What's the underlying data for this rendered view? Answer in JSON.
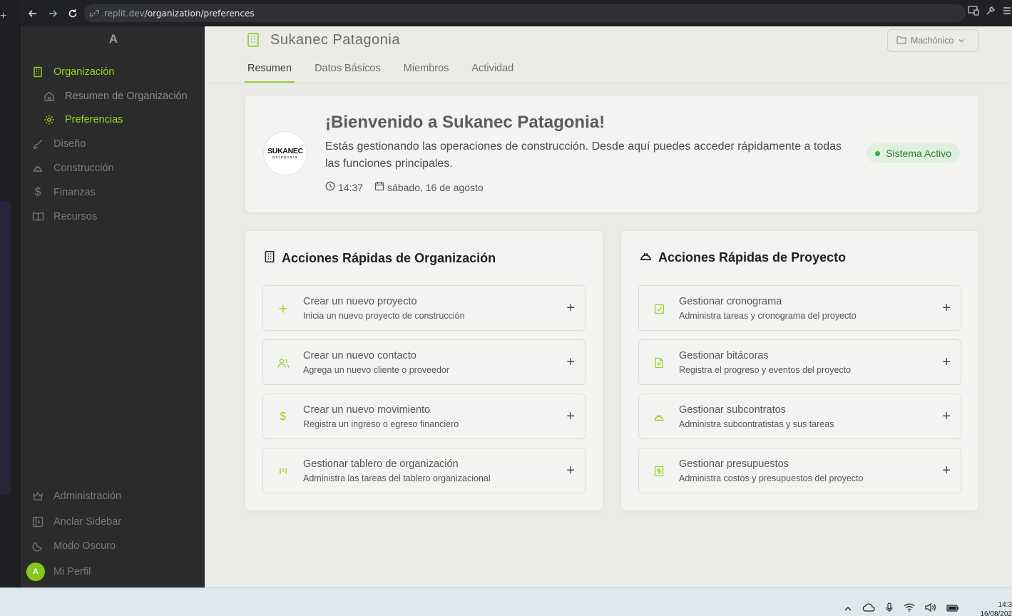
{
  "browser": {
    "url_host": ".replit.dev",
    "url_path": "/organization/preferences"
  },
  "sidebar": {
    "logo_letter": "A",
    "items": [
      {
        "label": "Organización",
        "icon": "building-icon",
        "active": true
      },
      {
        "label": "Resumen de Organización",
        "icon": "home-icon",
        "sub": true
      },
      {
        "label": "Preferencias",
        "icon": "gear-icon",
        "sub": true,
        "active": true
      },
      {
        "label": "Diseño",
        "icon": "brush-icon"
      },
      {
        "label": "Construcción",
        "icon": "hardhat-icon"
      },
      {
        "label": "Finanzas",
        "icon": "dollar-icon"
      },
      {
        "label": "Recursos",
        "icon": "book-icon"
      }
    ],
    "bottom": [
      {
        "label": "Administración",
        "icon": "crown-icon"
      },
      {
        "label": "Anclar Sidebar",
        "icon": "sidebar-icon"
      },
      {
        "label": "Modo Oscuro",
        "icon": "moon-icon"
      },
      {
        "label": "Mi Perfil",
        "avatar_letter": "A"
      }
    ]
  },
  "header": {
    "org_name": "Sukanec Patagonia",
    "project_select": "Machónico",
    "tabs": [
      "Resumen",
      "Datos Básicos",
      "Miembros",
      "Actividad"
    ],
    "active_tab": "Resumen"
  },
  "welcome": {
    "logo_text": "SUKANEC",
    "logo_subtext": "patagonia",
    "title": "¡Bienvenido a Sukanec Patagonia!",
    "description": "Estás gestionando las operaciones de construcción. Desde aquí puedes acceder rápidamente a todas las funciones principales.",
    "time": "14:37",
    "date": "sábado, 16 de agosto",
    "status": "Sistema Activo"
  },
  "org_actions": {
    "title": "Acciones Rápidas de Organización",
    "items": [
      {
        "title": "Crear un nuevo proyecto",
        "subtitle": "Inicia un nuevo proyecto de construcción",
        "icon": "plus-icon"
      },
      {
        "title": "Crear un nuevo contacto",
        "subtitle": "Agrega un nuevo cliente o proveedor",
        "icon": "users-icon"
      },
      {
        "title": "Crear un nuevo movimiento",
        "subtitle": "Registra un ingreso o egreso financiero",
        "icon": "dollar-icon"
      },
      {
        "title": "Gestionar tablero de organización",
        "subtitle": "Administra las tareas del tablero organizacional",
        "icon": "kanban-icon"
      }
    ]
  },
  "project_actions": {
    "title": "Acciones Rápidas de Proyecto",
    "items": [
      {
        "title": "Gestionar cronograma",
        "subtitle": "Administra tareas y cronograma del proyecto",
        "icon": "checkbox-icon"
      },
      {
        "title": "Gestionar bitácoras",
        "subtitle": "Registra el progreso y eventos del proyecto",
        "icon": "document-icon"
      },
      {
        "title": "Gestionar subcontratos",
        "subtitle": "Administra subcontratistas y sus tareas",
        "icon": "hardhat-icon"
      },
      {
        "title": "Gestionar presupuestos",
        "subtitle": "Administra costos y presupuestos del proyecto",
        "icon": "budget-icon"
      }
    ]
  },
  "taskbar": {
    "time": "14:3",
    "date": "16/08/202"
  },
  "colors": {
    "accent": "#9bd12a",
    "sidebar_bg": "#2b2b2b",
    "main_bg": "#ebebe8",
    "status_green": "#2fb34a"
  }
}
